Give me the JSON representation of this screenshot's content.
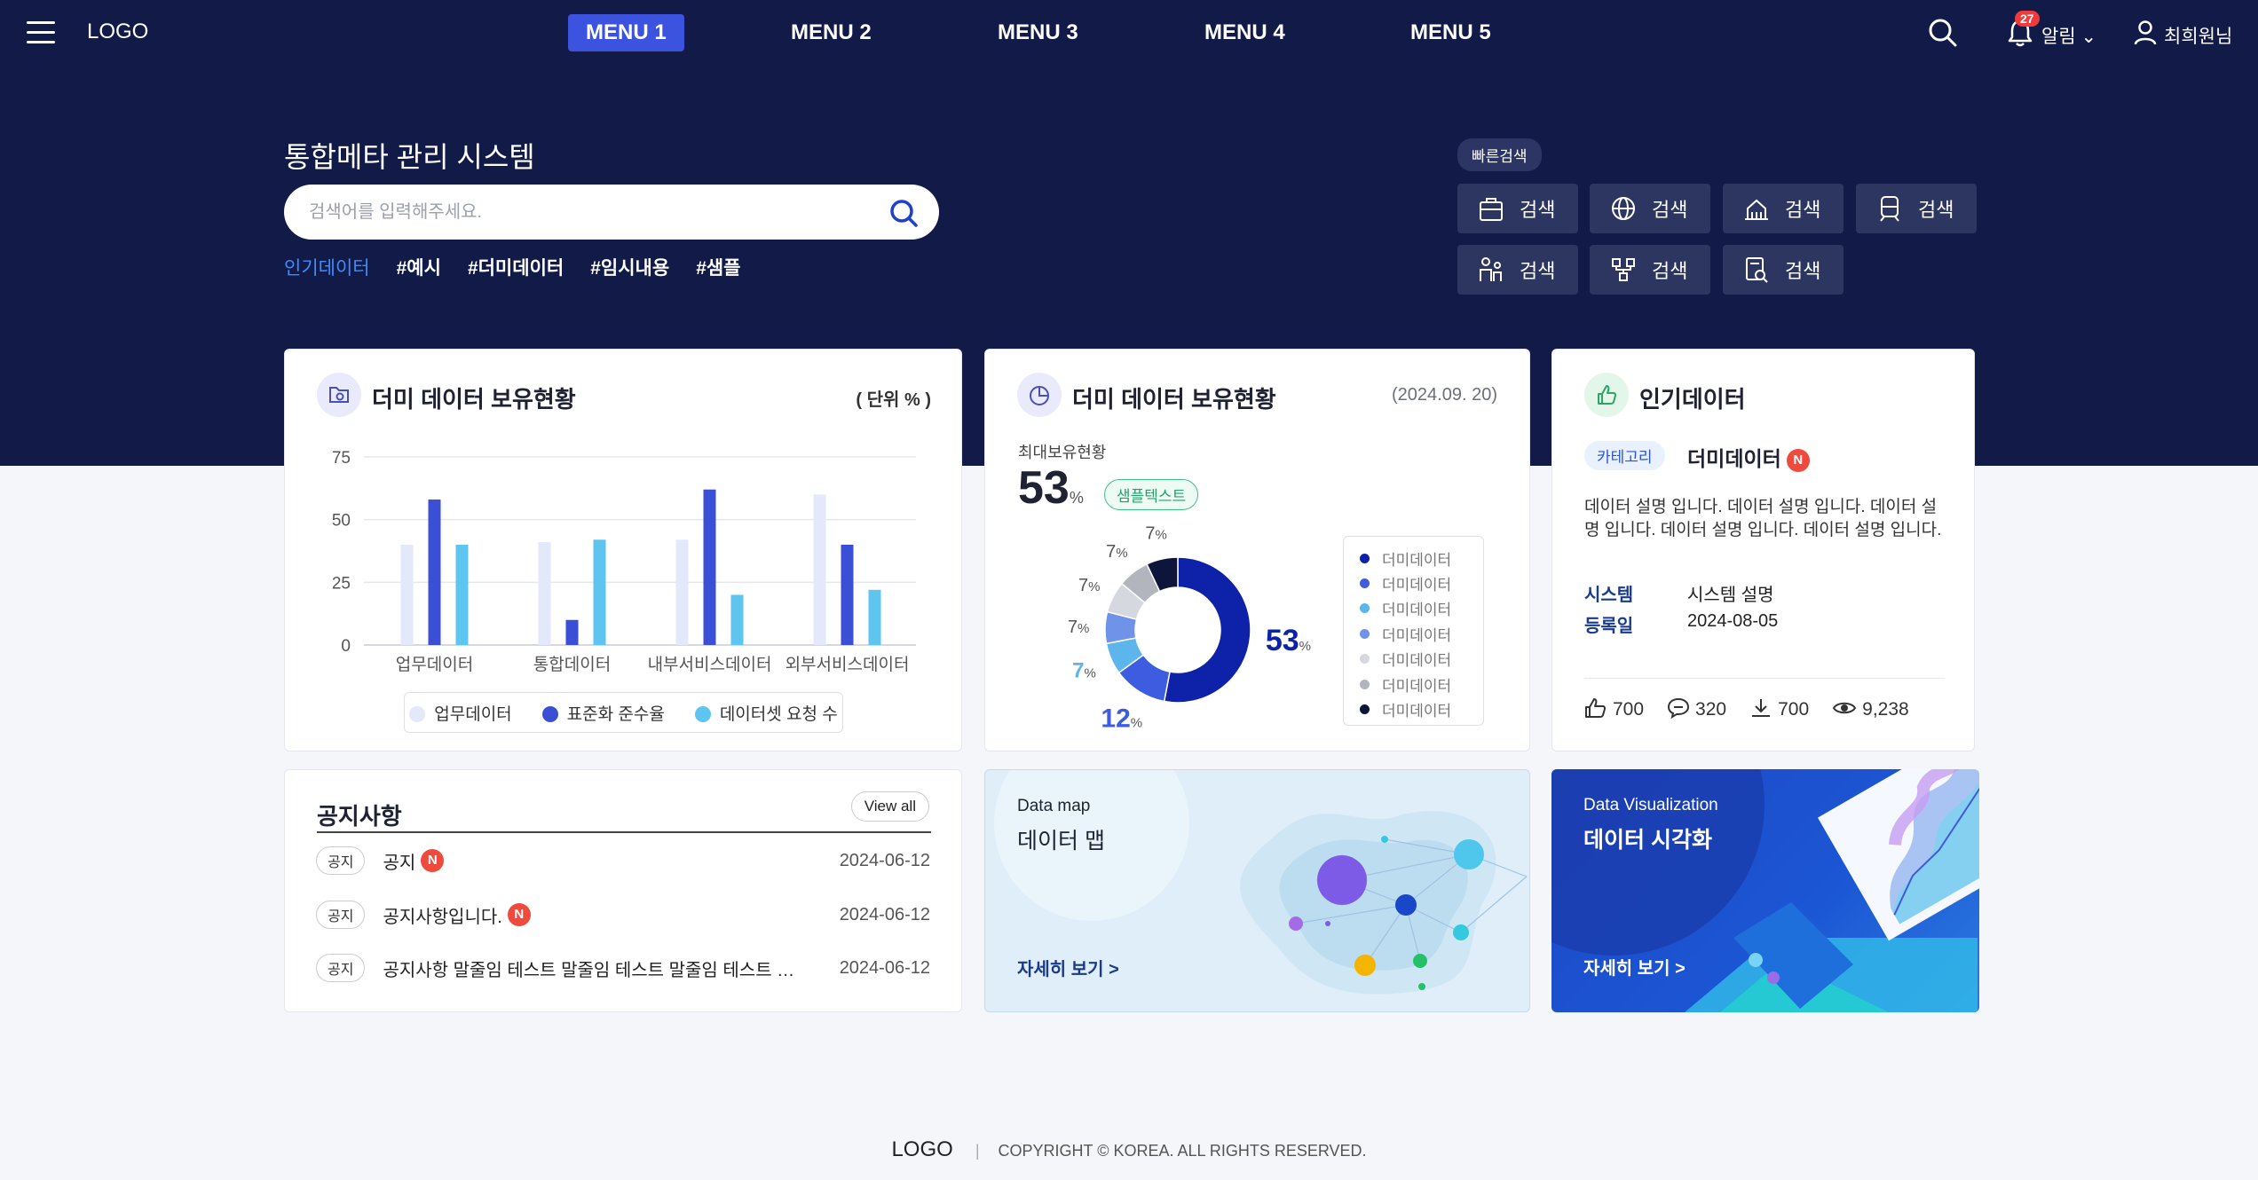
{
  "header": {
    "logo": "LOGO",
    "menus": [
      "MENU 1",
      "MENU 2",
      "MENU 3",
      "MENU 4",
      "MENU 5"
    ],
    "active_menu": "MENU 1",
    "alarm_count": "27",
    "alarm_label": "알림",
    "user_label": "최희원님"
  },
  "hero": {
    "title": "통합메타 관리 시스템",
    "search_placeholder": "검색어를 입력해주세요.",
    "popular_label": "인기데이터",
    "tags": [
      "#예시",
      "#더미데이터",
      "#임시내용",
      "#샘플"
    ],
    "quick_label": "빠른검색",
    "quick_buttons": [
      "검색",
      "검색",
      "검색",
      "검색",
      "검색",
      "검색",
      "검색"
    ]
  },
  "colors": {
    "navy": "#121a48",
    "accent": "#3c53df",
    "bar_light": "#e4e8fb",
    "bar_mid": "#3b4fd6",
    "bar_sky": "#5ec4f0"
  },
  "bar_card": {
    "title": "더미 데이터 보유현황",
    "unit": "( 단위 % )",
    "chart_data": {
      "type": "bar",
      "categories": [
        "업무데이터",
        "통합데이터",
        "내부서비스데이터",
        "외부서비스데이터"
      ],
      "series": [
        {
          "name": "업무데이터",
          "values": [
            40,
            41,
            42,
            60
          ],
          "color": "#e4e8fb"
        },
        {
          "name": "표준화 준수율",
          "values": [
            58,
            10,
            62,
            40
          ],
          "color": "#3b4fd6"
        },
        {
          "name": "데이터셋 요청 수",
          "values": [
            40,
            42,
            20,
            22
          ],
          "color": "#5ec4f0"
        }
      ],
      "yticks": [
        0,
        25,
        50,
        75
      ],
      "ylim": [
        0,
        75
      ],
      "grid": true,
      "legend": "bottom"
    }
  },
  "donut_card": {
    "title": "더미 데이터 보유현황",
    "date": "(2024.09. 20)",
    "max_label": "최대보유현황",
    "max_value": "53",
    "max_unit": "%",
    "sample_badge": "샘플텍스트",
    "chart_data": {
      "type": "pie",
      "labels": [
        "더미데이터",
        "더미데이터",
        "더미데이터",
        "더미데이터",
        "더미데이터",
        "더미데이터",
        "더미데이터"
      ],
      "values": [
        53,
        12,
        7,
        7,
        7,
        7,
        7
      ],
      "colors": [
        "#0d22a8",
        "#3d5ce0",
        "#5cb6ec",
        "#6f93e8",
        "#d5d8df",
        "#b2b5bd",
        "#0e153d"
      ],
      "legend": "right"
    },
    "pct_labels": [
      {
        "text": "53",
        "unit": "%"
      },
      {
        "text": "12",
        "unit": "%"
      },
      {
        "text": "7",
        "unit": "%"
      },
      {
        "text": "7",
        "unit": "%"
      },
      {
        "text": "7",
        "unit": "%"
      },
      {
        "text": "7",
        "unit": "%"
      },
      {
        "text": "7",
        "unit": "%"
      }
    ]
  },
  "popular_card": {
    "title": "인기데이터",
    "category": "카테고리",
    "data_title": "더미데이터",
    "new_badge": "N",
    "description": "데이터 설명 입니다. 데이터 설명 입니다. 데이터 설명 입니다. 데이터 설명 입니다. 데이터 설명 입니다.",
    "system_label": "시스템",
    "system_value": "시스템 설명",
    "date_label": "등록일",
    "date_value": "2024-08-05",
    "stats": {
      "likes": "700",
      "comments": "320",
      "downloads": "700",
      "views": "9,238"
    }
  },
  "notice_card": {
    "title": "공지사항",
    "view_all": "View all",
    "items": [
      {
        "tag": "공지",
        "text": "공지",
        "new": true,
        "date": "2024-06-12"
      },
      {
        "tag": "공지",
        "text": "공지사항입니다.",
        "new": true,
        "date": "2024-06-12"
      },
      {
        "tag": "공지",
        "text": "공지사항 말줄임 테스트 말줄임 테스트 말줄임 테스트 말줄임 테스트",
        "new": false,
        "date": "2024-06-12"
      }
    ]
  },
  "datamap_card": {
    "eyebrow": "Data map",
    "title": "데이터 맵",
    "link": "자세히 보기 >"
  },
  "dataviz_card": {
    "eyebrow": "Data Visualization",
    "title": "데이터 시각화",
    "link": "자세히 보기 >"
  },
  "footer": {
    "logo": "LOGO",
    "copyright": "COPYRIGHT © KOREA. ALL RIGHTS RESERVED."
  }
}
